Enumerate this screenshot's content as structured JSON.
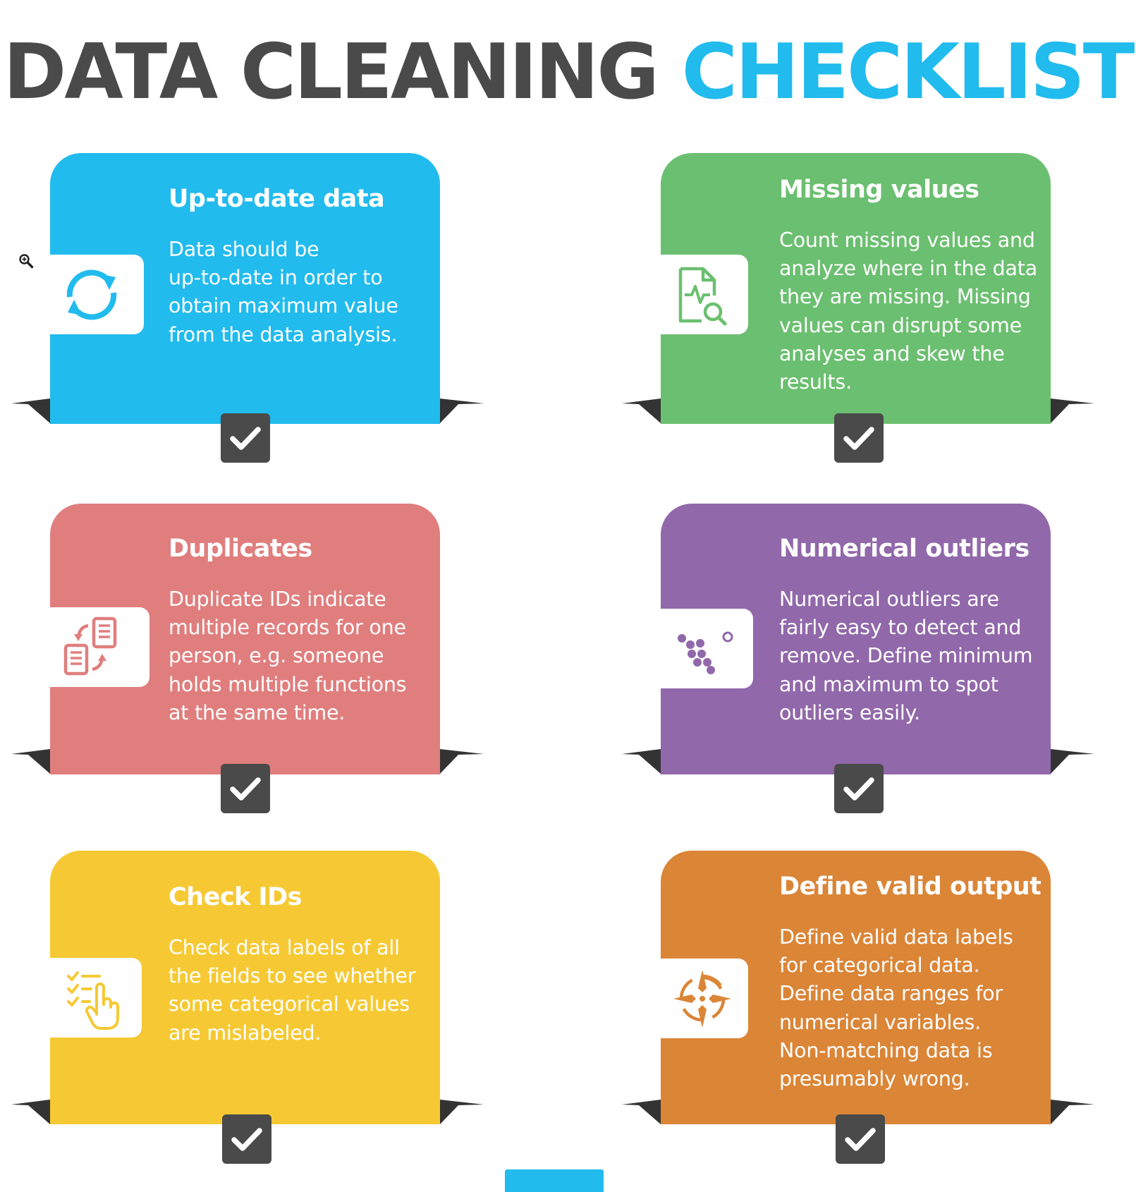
{
  "title": {
    "part1": "DATA CLEANING",
    "part2": "CHECKLIST"
  },
  "colors": {
    "title_dark": "#4a4a4a",
    "title_accent": "#21bbee",
    "check_box": "#4a4a4a"
  },
  "cards": [
    {
      "heading": "Up-to-date data",
      "body": "Data should be\nup-to-date in order to\nobtain maximum value\nfrom the data analysis.",
      "color": "#21bbee",
      "icon": "refresh-icon"
    },
    {
      "heading": "Missing values",
      "body": "Count missing values and\nanalyze where in the data\nthey are missing. Missing\nvalues can disrupt some\nanalyses and skew the\nresults.",
      "color": "#6bbf70",
      "icon": "document-search-icon"
    },
    {
      "heading": "Duplicates",
      "body": "Duplicate IDs indicate\nmultiple records for one\nperson, e.g. someone\nholds multiple functions\nat the same time.",
      "color": "#e07e7e",
      "icon": "duplicate-documents-icon"
    },
    {
      "heading": "Numerical outliers",
      "body": "Numerical outliers are\nfairly easy to detect and\nremove. Define minimum\nand maximum to spot\noutliers easily.",
      "color": "#9168aa",
      "icon": "scatter-outlier-icon"
    },
    {
      "heading": "Check IDs",
      "body": "Check data labels of all\nthe fields to see whether\nsome categorical values\nare mislabeled.",
      "color": "#f6c934",
      "icon": "checklist-hand-icon"
    },
    {
      "heading": "Define valid output",
      "body": "Define valid data labels\nfor categorical data.\nDefine data ranges for\nnumerical variables.\nNon-matching data is\npresumably wrong.",
      "color": "#db8537",
      "icon": "target-crosshair-icon"
    }
  ]
}
